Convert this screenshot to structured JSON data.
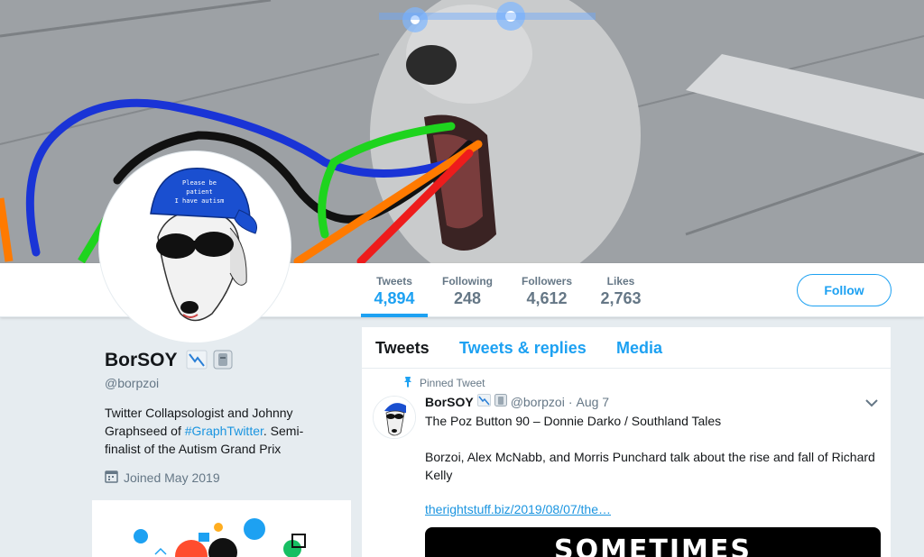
{
  "banner": {
    "image": "dog-photo-banner"
  },
  "profile": {
    "name": "BorSOY",
    "handle": "@borpzoi",
    "bio_before": "Twitter Collapsologist and Johnny Graphseed of ",
    "bio_link": "#GraphTwitter",
    "bio_after": ". Semi-finalist of the Autism Grand Prix",
    "joined": "Joined May 2019",
    "avatar_hat_text": "Please be patient I have autism"
  },
  "stats": [
    {
      "label": "Tweets",
      "value": "4,894"
    },
    {
      "label": "Following",
      "value": "248"
    },
    {
      "label": "Followers",
      "value": "4,612"
    },
    {
      "label": "Likes",
      "value": "2,763"
    }
  ],
  "follow_label": "Follow",
  "tabs": [
    {
      "label": "Tweets"
    },
    {
      "label": "Tweets & replies"
    },
    {
      "label": "Media"
    }
  ],
  "tweet": {
    "pinned_label": "Pinned Tweet",
    "name": "BorSOY",
    "handle": "@borpzoi",
    "separator": "·",
    "date": "Aug 7",
    "line1": "The Poz Button 90 – Donnie Darko / Southland Tales",
    "line2": "Borzoi, Alex McNabb, and Morris Punchard talk about the rise and fall of Richard Kelly",
    "link": "therightstuff.biz/2019/08/07/the…",
    "card_text": "SOMETIMES"
  },
  "colors": {
    "accent": "#1da1f2",
    "link": "#1b95e0",
    "muted": "#657786",
    "background": "#e6ecf0"
  }
}
